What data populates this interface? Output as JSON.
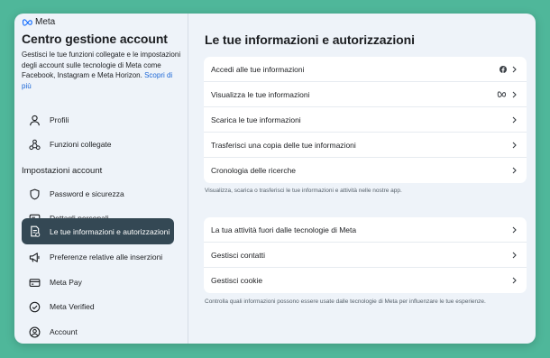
{
  "brand": {
    "name": "Meta"
  },
  "sidebar": {
    "title": "Centro gestione account",
    "description": "Gestisci le tue funzioni collegate e le impostazioni degli account sulle tecnologie di Meta come Facebook, Instagram e Meta Horizon.",
    "learn_more": "Scopri di più",
    "items_top": [
      {
        "label": "Profili",
        "icon": "person-icon"
      },
      {
        "label": "Funzioni collegate",
        "icon": "connected-features-icon"
      }
    ],
    "section_label": "Impostazioni account",
    "items_settings": [
      {
        "label": "Password e sicurezza",
        "icon": "shield-icon"
      },
      {
        "label": "Dettagli personali",
        "icon": "id-card-icon"
      },
      {
        "label": "Le tue informazioni e autorizzazioni",
        "icon": "info-document-icon",
        "active": true
      },
      {
        "label": "Preferenze relative alle inserzioni",
        "icon": "megaphone-icon"
      },
      {
        "label": "Meta Pay",
        "icon": "credit-card-icon"
      },
      {
        "label": "Meta Verified",
        "icon": "verified-badge-icon"
      },
      {
        "label": "Account",
        "icon": "account-circle-icon"
      }
    ]
  },
  "main": {
    "title": "Le tue informazioni e autorizzazioni",
    "group1": [
      {
        "label": "Accedi alle tue informazioni",
        "icon": "facebook-icon"
      },
      {
        "label": "Visualizza le tue informazioni",
        "icon": "meta-icon"
      },
      {
        "label": "Scarica le tue informazioni"
      },
      {
        "label": "Trasferisci una copia delle tue informazioni"
      },
      {
        "label": "Cronologia delle ricerche"
      }
    ],
    "group1_note": "Visualizza, scarica o trasferisci le tue informazioni e attività nelle nostre app.",
    "group2": [
      {
        "label": "La tua attività fuori dalle tecnologie di Meta"
      },
      {
        "label": "Gestisci contatti"
      },
      {
        "label": "Gestisci cookie"
      }
    ],
    "group2_note": "Controlla quali informazioni possono essere usate dalle tecnologie di Meta per influenzare le tue esperienze."
  },
  "colors": {
    "backdrop": "#4fb79a",
    "panel": "#eef3f9",
    "active_item": "#344854",
    "link": "#1b66d6"
  }
}
